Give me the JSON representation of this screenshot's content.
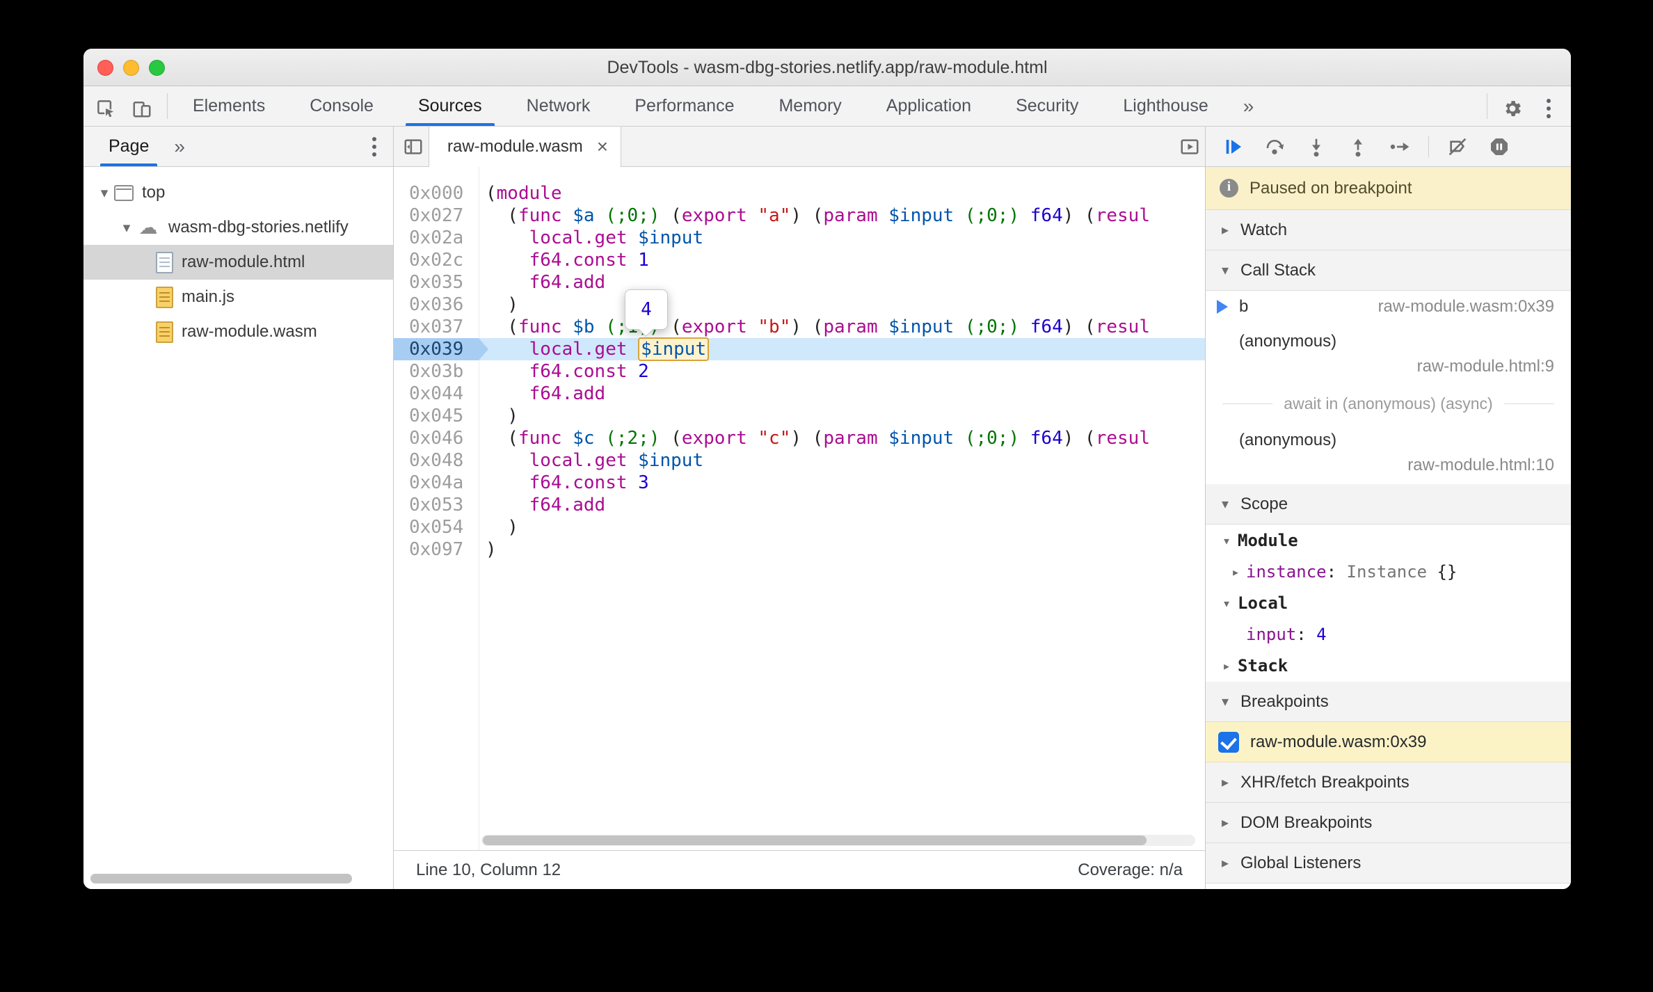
{
  "window": {
    "title": "DevTools - wasm-dbg-stories.netlify.app/raw-module.html"
  },
  "colors": {
    "accent_blue": "#1a73e8",
    "paused_banner_bg": "#faf1ca",
    "breakpoint_row_bg": "#fbf3c6",
    "keyword": "#aa0d91",
    "string": "#c41a16",
    "number": "#1c00cf",
    "variable": "#0055aa",
    "comment": "#007400"
  },
  "glyphs": {
    "expanded": "▾",
    "collapsed": "▸",
    "close": "×",
    "overflow": "»"
  },
  "toolbar": {
    "tabs": [
      "Elements",
      "Console",
      "Sources",
      "Network",
      "Performance",
      "Memory",
      "Application",
      "Security",
      "Lighthouse"
    ],
    "active": "Sources",
    "overflow": "»"
  },
  "sidebar": {
    "tab": "Page",
    "more": "»",
    "tree": [
      {
        "label": "top",
        "icon": "frame",
        "depth": 0,
        "arrow": "▾"
      },
      {
        "label": "wasm-dbg-stories.netlify",
        "icon": "cloud",
        "glyph": "☁",
        "depth": 1,
        "arrow": "▾"
      },
      {
        "label": "raw-module.html",
        "icon": "doc",
        "depth": 2,
        "selected": true
      },
      {
        "label": "main.js",
        "icon": "script",
        "depth": 2
      },
      {
        "label": "raw-module.wasm",
        "icon": "script",
        "depth": 2
      }
    ]
  },
  "editor": {
    "tab": "raw-module.wasm",
    "close_glyph": "×",
    "tooltip_value": "4",
    "status": {
      "left": "Line 10, Column 12",
      "right": "Coverage: n/a"
    },
    "lines": [
      {
        "addr": "0x000",
        "tokens": [
          [
            "p",
            "("
          ],
          [
            "kw",
            "module"
          ]
        ]
      },
      {
        "addr": "0x027",
        "tokens": [
          [
            "p",
            "  ("
          ],
          [
            "kw",
            "func"
          ],
          [
            "p",
            " "
          ],
          [
            "var",
            "$a"
          ],
          [
            "p",
            " "
          ],
          [
            "com",
            "(;0;)"
          ],
          [
            "p",
            " ("
          ],
          [
            "kw",
            "export"
          ],
          [
            "p",
            " "
          ],
          [
            "str",
            "\"a\""
          ],
          [
            "p",
            ") ("
          ],
          [
            "kw",
            "param"
          ],
          [
            "p",
            " "
          ],
          [
            "var",
            "$input"
          ],
          [
            "p",
            " "
          ],
          [
            "com",
            "(;0;)"
          ],
          [
            "p",
            " "
          ],
          [
            "typ",
            "f64"
          ],
          [
            "p",
            ") ("
          ],
          [
            "kw",
            "resul"
          ]
        ]
      },
      {
        "addr": "0x02a",
        "tokens": [
          [
            "p",
            "    "
          ],
          [
            "kw",
            "local.get"
          ],
          [
            "p",
            " "
          ],
          [
            "var",
            "$input"
          ]
        ]
      },
      {
        "addr": "0x02c",
        "tokens": [
          [
            "p",
            "    "
          ],
          [
            "kw",
            "f64.const"
          ],
          [
            "p",
            " "
          ],
          [
            "num",
            "1"
          ]
        ]
      },
      {
        "addr": "0x035",
        "tokens": [
          [
            "p",
            "    "
          ],
          [
            "kw",
            "f64.add"
          ]
        ]
      },
      {
        "addr": "0x036",
        "tokens": [
          [
            "p",
            "  )"
          ]
        ]
      },
      {
        "addr": "0x037",
        "tokens": [
          [
            "p",
            "  ("
          ],
          [
            "kw",
            "func"
          ],
          [
            "p",
            " "
          ],
          [
            "var",
            "$b"
          ],
          [
            "p",
            " "
          ],
          [
            "com",
            "(;1;)"
          ],
          [
            "p",
            " ("
          ],
          [
            "kw",
            "export"
          ],
          [
            "p",
            " "
          ],
          [
            "str",
            "\"b\""
          ],
          [
            "p",
            ") ("
          ],
          [
            "kw",
            "param"
          ],
          [
            "p",
            " "
          ],
          [
            "var",
            "$input"
          ],
          [
            "p",
            " "
          ],
          [
            "com",
            "(;0;)"
          ],
          [
            "p",
            " "
          ],
          [
            "typ",
            "f64"
          ],
          [
            "p",
            ") ("
          ],
          [
            "kw",
            "resul"
          ]
        ]
      },
      {
        "addr": "0x039",
        "paused": true,
        "tokens": [
          [
            "p",
            "    "
          ],
          [
            "kw",
            "local.get"
          ],
          [
            "p",
            " "
          ],
          [
            "varbox",
            "$input"
          ]
        ]
      },
      {
        "addr": "0x03b",
        "tokens": [
          [
            "p",
            "    "
          ],
          [
            "kw",
            "f64.const"
          ],
          [
            "p",
            " "
          ],
          [
            "num",
            "2"
          ]
        ]
      },
      {
        "addr": "0x044",
        "tokens": [
          [
            "p",
            "    "
          ],
          [
            "kw",
            "f64.add"
          ]
        ]
      },
      {
        "addr": "0x045",
        "tokens": [
          [
            "p",
            "  )"
          ]
        ]
      },
      {
        "addr": "0x046",
        "tokens": [
          [
            "p",
            "  ("
          ],
          [
            "kw",
            "func"
          ],
          [
            "p",
            " "
          ],
          [
            "var",
            "$c"
          ],
          [
            "p",
            " "
          ],
          [
            "com",
            "(;2;)"
          ],
          [
            "p",
            " ("
          ],
          [
            "kw",
            "export"
          ],
          [
            "p",
            " "
          ],
          [
            "str",
            "\"c\""
          ],
          [
            "p",
            ") ("
          ],
          [
            "kw",
            "param"
          ],
          [
            "p",
            " "
          ],
          [
            "var",
            "$input"
          ],
          [
            "p",
            " "
          ],
          [
            "com",
            "(;0;)"
          ],
          [
            "p",
            " "
          ],
          [
            "typ",
            "f64"
          ],
          [
            "p",
            ") ("
          ],
          [
            "kw",
            "resul"
          ]
        ]
      },
      {
        "addr": "0x048",
        "tokens": [
          [
            "p",
            "    "
          ],
          [
            "kw",
            "local.get"
          ],
          [
            "p",
            " "
          ],
          [
            "var",
            "$input"
          ]
        ]
      },
      {
        "addr": "0x04a",
        "tokens": [
          [
            "p",
            "    "
          ],
          [
            "kw",
            "f64.const"
          ],
          [
            "p",
            " "
          ],
          [
            "num",
            "3"
          ]
        ]
      },
      {
        "addr": "0x053",
        "tokens": [
          [
            "p",
            "    "
          ],
          [
            "kw",
            "f64.add"
          ]
        ]
      },
      {
        "addr": "0x054",
        "tokens": [
          [
            "p",
            "  )"
          ]
        ]
      },
      {
        "addr": "0x097",
        "tokens": [
          [
            "p",
            ")"
          ]
        ]
      }
    ]
  },
  "debugger_pane": {
    "paused_message": "Paused on breakpoint",
    "watch": {
      "title": "Watch",
      "collapsed": true
    },
    "call_stack": {
      "title": "Call Stack",
      "frames": [
        {
          "name": "b",
          "location": "raw-module.wasm:0x39",
          "current": true
        },
        {
          "name": "(anonymous)",
          "location": "raw-module.html:9",
          "two_line": true
        },
        {
          "type": "divider",
          "label": "await in (anonymous) (async)"
        },
        {
          "name": "(anonymous)",
          "location": "raw-module.html:10",
          "two_line": true
        }
      ]
    },
    "scope": {
      "title": "Scope",
      "groups": [
        {
          "name": "Module",
          "expanded": true,
          "vars": [
            {
              "name": "instance",
              "expandable": true,
              "value_parts": [
                {
                  "text": "Instance ",
                  "cls": "gray"
                },
                {
                  "text": "{}",
                  "cls": "dark"
                }
              ]
            }
          ]
        },
        {
          "name": "Local",
          "expanded": true,
          "vars": [
            {
              "name": "input",
              "value_parts": [
                {
                  "text": "4",
                  "cls": "blue"
                }
              ]
            }
          ]
        },
        {
          "name": "Stack",
          "expanded": false,
          "vars": []
        }
      ]
    },
    "breakpoints": {
      "title": "Breakpoints",
      "items": [
        {
          "label": "raw-module.wasm:0x39",
          "checked": true
        }
      ]
    },
    "more_sections": [
      "XHR/fetch Breakpoints",
      "DOM Breakpoints",
      "Global Listeners"
    ]
  }
}
